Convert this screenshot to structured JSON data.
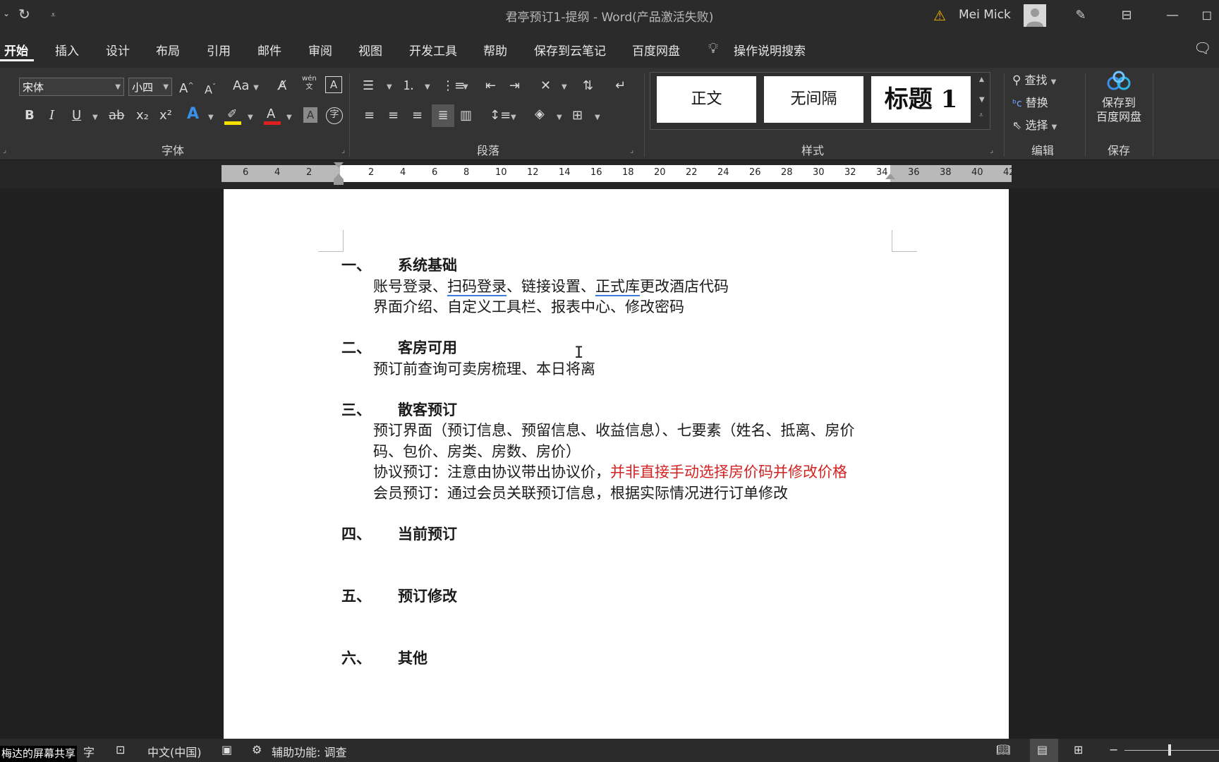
{
  "window": {
    "title": "君亭预订1-提纲  -  Word(产品激活失败)",
    "user_name": "Mei Mick",
    "undo_icon": "undo-arrow-icon"
  },
  "tabs": [
    "开始",
    "插入",
    "设计",
    "布局",
    "引用",
    "邮件",
    "审阅",
    "视图",
    "开发工具",
    "帮助",
    "保存到云笔记",
    "百度网盘"
  ],
  "tell_me": "操作说明搜索",
  "ribbon": {
    "font": {
      "label": "字体",
      "font_name": "宋体",
      "font_size": "小四",
      "case_label": "Aa",
      "grow_label": "A",
      "shrink_label": "A",
      "pinyin_label": "wén",
      "bold": "B",
      "italic": "I",
      "underline": "U",
      "strike": "ab",
      "subscript": "x₂",
      "superscript": "x²",
      "font_color": "A",
      "highlight_color": "#f5e000",
      "font_color_value": "#e02020",
      "char_shading": "A",
      "enclose": "字"
    },
    "paragraph": {
      "label": "段落"
    },
    "styles": {
      "label": "样式",
      "items": [
        "正文",
        "无间隔",
        "标题 1"
      ]
    },
    "editing": {
      "label": "编辑",
      "find": "查找",
      "replace": "替换",
      "select": "选择"
    },
    "save": {
      "label": "保存",
      "button_line1": "保存到",
      "button_line2": "百度网盘"
    }
  },
  "ruler": {
    "left_numbers": [
      "6",
      "4",
      "2"
    ],
    "right_numbers": [
      "2",
      "4",
      "6",
      "8",
      "10",
      "12",
      "14",
      "16",
      "18",
      "20",
      "22",
      "24",
      "26",
      "28",
      "30",
      "32",
      "34",
      "36",
      "38",
      "40",
      "42"
    ]
  },
  "document": {
    "sections": [
      {
        "num": "一、",
        "title": "系统基础",
        "lines": [
          {
            "parts": [
              {
                "t": "账号登录、"
              },
              {
                "t": "扫码登录",
                "u": true
              },
              {
                "t": "、链接设置、"
              },
              {
                "t": "正式库",
                "u": true
              },
              {
                "t": "更改酒店代码"
              }
            ]
          },
          {
            "parts": [
              {
                "t": "界面介绍、自定义工具栏、报表中心、修改密码"
              }
            ]
          }
        ]
      },
      {
        "num": "二、",
        "title": "客房可用",
        "lines": [
          {
            "parts": [
              {
                "t": "预订前查询可卖房梳理、本日将离"
              }
            ]
          }
        ]
      },
      {
        "num": "三、",
        "title": "散客预订",
        "lines": [
          {
            "parts": [
              {
                "t": "预订界面（预订信息、预留信息、收益信息）、七要素（姓名、抵离、房价"
              }
            ]
          },
          {
            "parts": [
              {
                "t": "码、包价、房类、房数、房价）"
              }
            ]
          },
          {
            "parts": [
              {
                "t": "协议预订：注意由协议带出协议价，"
              },
              {
                "t": "并非直接手动选择房价码并修改价格",
                "red": true
              }
            ]
          },
          {
            "parts": [
              {
                "t": "会员预订：通过会员关联预订信息，根据实际情况进行订单修改"
              }
            ]
          }
        ]
      },
      {
        "num": "四、",
        "title": "当前预订",
        "lines": []
      },
      {
        "num": "五、",
        "title": "预订修改",
        "lines": []
      },
      {
        "num": "六、",
        "title": "其他",
        "lines": []
      }
    ]
  },
  "status": {
    "words_label": "字",
    "language": "中文(中国)",
    "accessibility": "辅助功能: 调查",
    "share_overlay": "梅达的屏幕共享"
  }
}
